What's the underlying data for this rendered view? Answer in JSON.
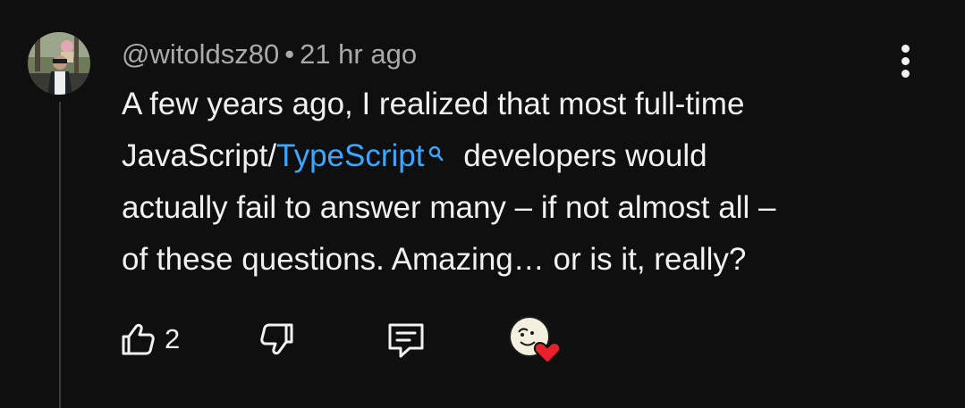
{
  "comment": {
    "author": "@witoldsz80",
    "separator": "•",
    "timestamp": "21 hr ago",
    "text_lines": [
      {
        "before": "A few years ago, I realized that most full-time"
      },
      {
        "before": "JavaScript/",
        "link": "TypeScript",
        "after": " developers would"
      },
      {
        "before": "actually fail to answer many – if not almost all –"
      },
      {
        "before": "of these questions. Amazing… or is it, really?"
      }
    ],
    "link_icon": "search-icon"
  },
  "actions": {
    "like_icon": "thumbs-up-icon",
    "like_count": "2",
    "dislike_icon": "thumbs-down-icon",
    "reply_icon": "reply-comment-icon",
    "creator_heart_icon": "creator-heart-icon"
  },
  "menu_icon": "more-vertical-icon",
  "colors": {
    "background": "#0f0f0f",
    "text": "#f1f1f1",
    "meta": "#aaaaaa",
    "link": "#3ea6ff",
    "heart": "#e8202b"
  }
}
